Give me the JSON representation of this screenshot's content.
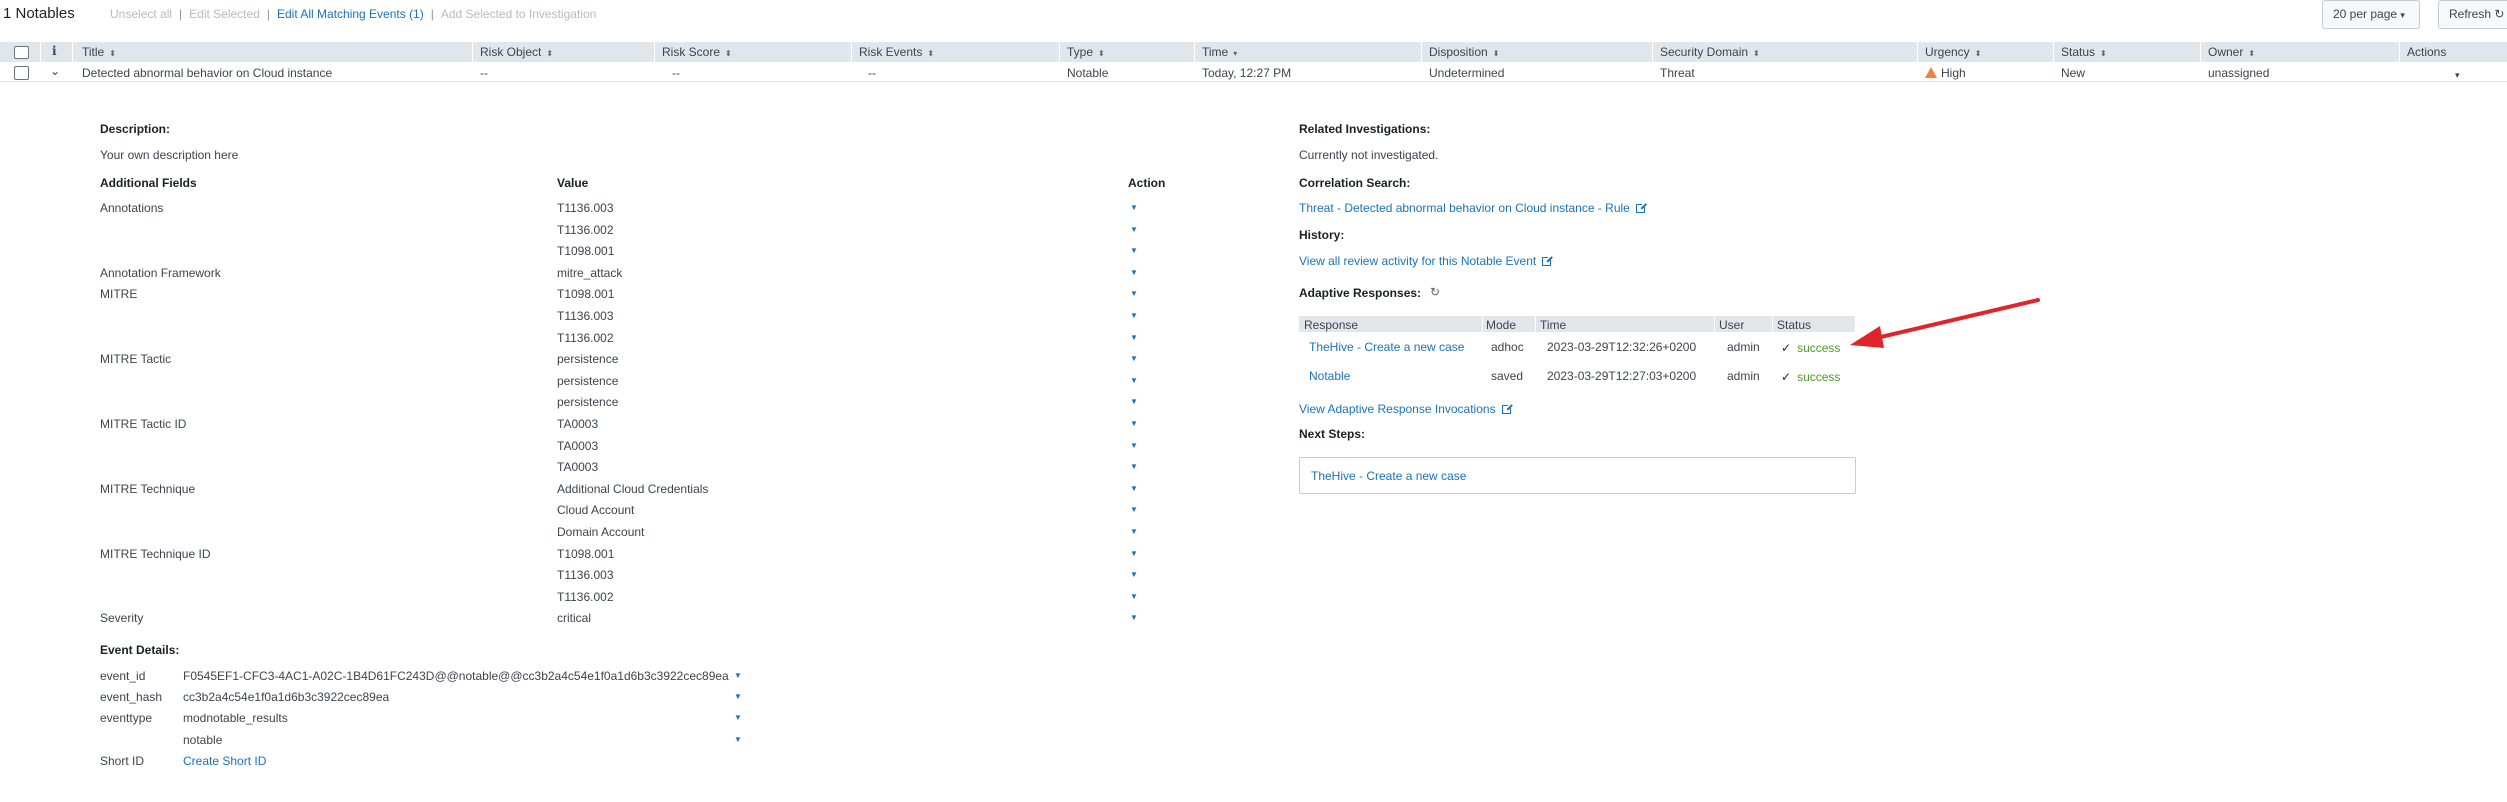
{
  "toolbar": {
    "count_label": "1 Notables",
    "unselect_all": "Unselect all",
    "edit_selected": "Edit Selected",
    "edit_all": "Edit All Matching Events (1)",
    "add_to_investigation": "Add Selected to Investigation",
    "per_page": "20 per page",
    "refresh": "Refresh"
  },
  "table": {
    "info_icon": "i",
    "columns": {
      "title": "Title",
      "risk_object": "Risk Object",
      "risk_score": "Risk Score",
      "risk_events": "Risk Events",
      "type": "Type",
      "time": "Time",
      "disposition": "Disposition",
      "security_domain": "Security Domain",
      "urgency": "Urgency",
      "status": "Status",
      "owner": "Owner",
      "actions": "Actions"
    },
    "row": {
      "title": "Detected abnormal behavior on Cloud instance",
      "risk_object": "--",
      "risk_score": "--",
      "risk_events": "--",
      "type": "Notable",
      "time": "Today, 12:27 PM",
      "disposition": "Undetermined",
      "security_domain": "Threat",
      "urgency": "High",
      "status": "New",
      "owner": "unassigned"
    }
  },
  "details": {
    "description_label": "Description:",
    "description": "Your own description here",
    "fields_header": "Additional Fields",
    "value_header": "Value",
    "action_header": "Action",
    "fields": [
      {
        "name": "Annotations",
        "value": "T1136.003"
      },
      {
        "name": "",
        "value": "T1136.002"
      },
      {
        "name": "",
        "value": "T1098.001"
      },
      {
        "name": "Annotation Framework",
        "value": "mitre_attack"
      },
      {
        "name": "MITRE",
        "value": "T1098.001"
      },
      {
        "name": "",
        "value": "T1136.003"
      },
      {
        "name": "",
        "value": "T1136.002"
      },
      {
        "name": "MITRE Tactic",
        "value": "persistence"
      },
      {
        "name": "",
        "value": "persistence"
      },
      {
        "name": "",
        "value": "persistence"
      },
      {
        "name": "MITRE Tactic ID",
        "value": "TA0003"
      },
      {
        "name": "",
        "value": "TA0003"
      },
      {
        "name": "",
        "value": "TA0003"
      },
      {
        "name": "MITRE Technique",
        "value": "Additional Cloud Credentials"
      },
      {
        "name": "",
        "value": "Cloud Account"
      },
      {
        "name": "",
        "value": "Domain Account"
      },
      {
        "name": "MITRE Technique ID",
        "value": "T1098.001"
      },
      {
        "name": "",
        "value": "T1136.003"
      },
      {
        "name": "",
        "value": "T1136.002"
      },
      {
        "name": "Severity",
        "value": "critical"
      }
    ],
    "event_details_label": "Event Details:",
    "event_fields": [
      {
        "name": "event_id",
        "value": "F0545EF1-CFC3-4AC1-A02C-1B4D61FC243D@@notable@@cc3b2a4c54e1f0a1d6b3c3922cec89ea"
      },
      {
        "name": "event_hash",
        "value": "cc3b2a4c54e1f0a1d6b3c3922cec89ea"
      },
      {
        "name": "eventtype",
        "value": "modnotable_results"
      },
      {
        "name": "",
        "value": "notable"
      }
    ],
    "short_id_label": "Short ID",
    "short_id_link": "Create Short ID"
  },
  "right": {
    "related_label": "Related Investigations:",
    "related_value": "Currently not investigated.",
    "correlation_label": "Correlation Search:",
    "correlation_link": "Threat - Detected abnormal behavior on Cloud instance - Rule",
    "history_label": "History:",
    "history_link": "View all review activity for this Notable Event",
    "adaptive_label": "Adaptive Responses:",
    "ar_columns": {
      "response": "Response",
      "mode": "Mode",
      "time": "Time",
      "user": "User",
      "status": "Status"
    },
    "ar_rows": [
      {
        "response": "TheHive - Create a new case",
        "mode": "adhoc",
        "time": "2023-03-29T12:32:26+0200",
        "user": "admin",
        "status": "success"
      },
      {
        "response": "Notable",
        "mode": "saved",
        "time": "2023-03-29T12:27:03+0200",
        "user": "admin",
        "status": "success"
      }
    ],
    "view_invocations": "View Adaptive Response Invocations",
    "next_steps_label": "Next Steps:",
    "next_step_link": "TheHive - Create a new case"
  },
  "colors": {
    "link": "#1a73b8",
    "success": "#4c9a2a",
    "warning": "#f1813f",
    "annotation_arrow": "#e0242b",
    "header_bg": "#e1e6eb"
  },
  "icons": [
    "info-icon",
    "chevron-down-icon",
    "warning-icon",
    "caret-down-icon",
    "external-link-icon",
    "refresh-icon",
    "check-icon",
    "annotation-arrow"
  ]
}
